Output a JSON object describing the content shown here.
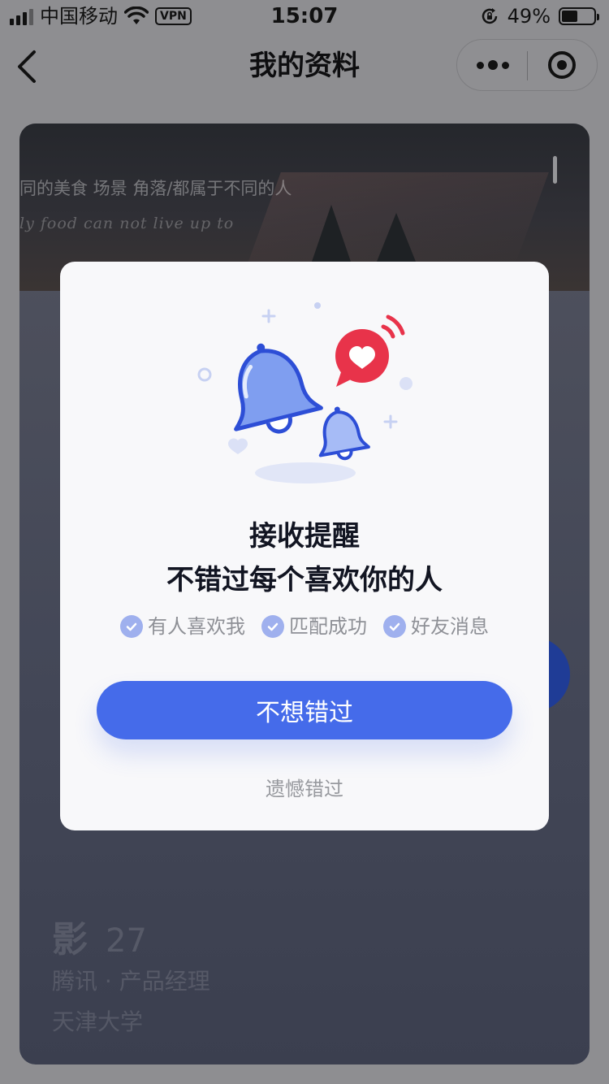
{
  "status_bar": {
    "carrier": "中国移动",
    "vpn": "VPN",
    "time": "15:07",
    "battery_percent": "49%",
    "battery_level": 0.49,
    "signal_bars_active": 3,
    "signal_bars_total": 4
  },
  "nav": {
    "title": "我的资料",
    "back_icon": "chevron-left-icon",
    "more_icon": "more-dots-icon",
    "close_icon": "target-circle-icon"
  },
  "profile": {
    "cover_text_line1": "同的美食 场景 角落/都属于不同的人",
    "cover_text_line2": "ly food can not live up to",
    "name": "影",
    "age": "27",
    "job": "腾讯 · 产品经理",
    "school": "天津大学"
  },
  "modal": {
    "illustration_icon": "notification-bells-icon",
    "title": "接收提醒",
    "subtitle": "不错过每个喜欢你的人",
    "features": [
      {
        "label": "有人喜欢我",
        "icon": "check-circle-icon"
      },
      {
        "label": "匹配成功",
        "icon": "check-circle-icon"
      },
      {
        "label": "好友消息",
        "icon": "check-circle-icon"
      }
    ],
    "primary_button": "不想错过",
    "secondary_button": "遗憾错过"
  },
  "colors": {
    "accent": "#456bea",
    "check": "#9fb0ee",
    "heart_badge": "#e8334a",
    "background_dim": "#8e8e91"
  }
}
